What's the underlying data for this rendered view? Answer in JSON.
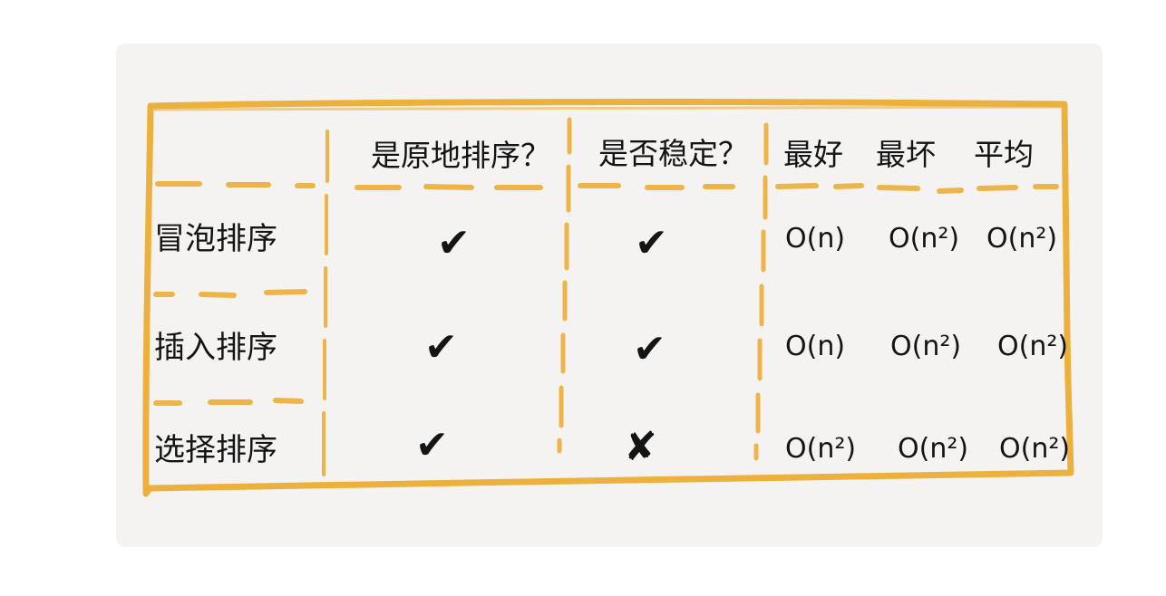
{
  "table": {
    "headers": {
      "in_place": "是原地排序？",
      "stable": "是否稳定？",
      "best": "最好",
      "worst": "最坏",
      "average": "平均"
    },
    "rows": [
      {
        "name": "冒泡排序",
        "in_place": "✔",
        "stable": "✔",
        "best": "O(n)",
        "worst": "O(n²)",
        "average": "O(n²)"
      },
      {
        "name": "插入排序",
        "in_place": "✔",
        "stable": "✔",
        "best": "O(n)",
        "worst": "O(n²)",
        "average": "O(n²)"
      },
      {
        "name": "选择排序",
        "in_place": "✔",
        "stable": "✘",
        "best": "O(n²)",
        "worst": "O(n²)",
        "average": "O(n²)"
      }
    ]
  },
  "colors": {
    "card_background": "#f4f3f1",
    "frame": "#ecb13c",
    "dash": "#efb447",
    "ink": "#141414"
  }
}
